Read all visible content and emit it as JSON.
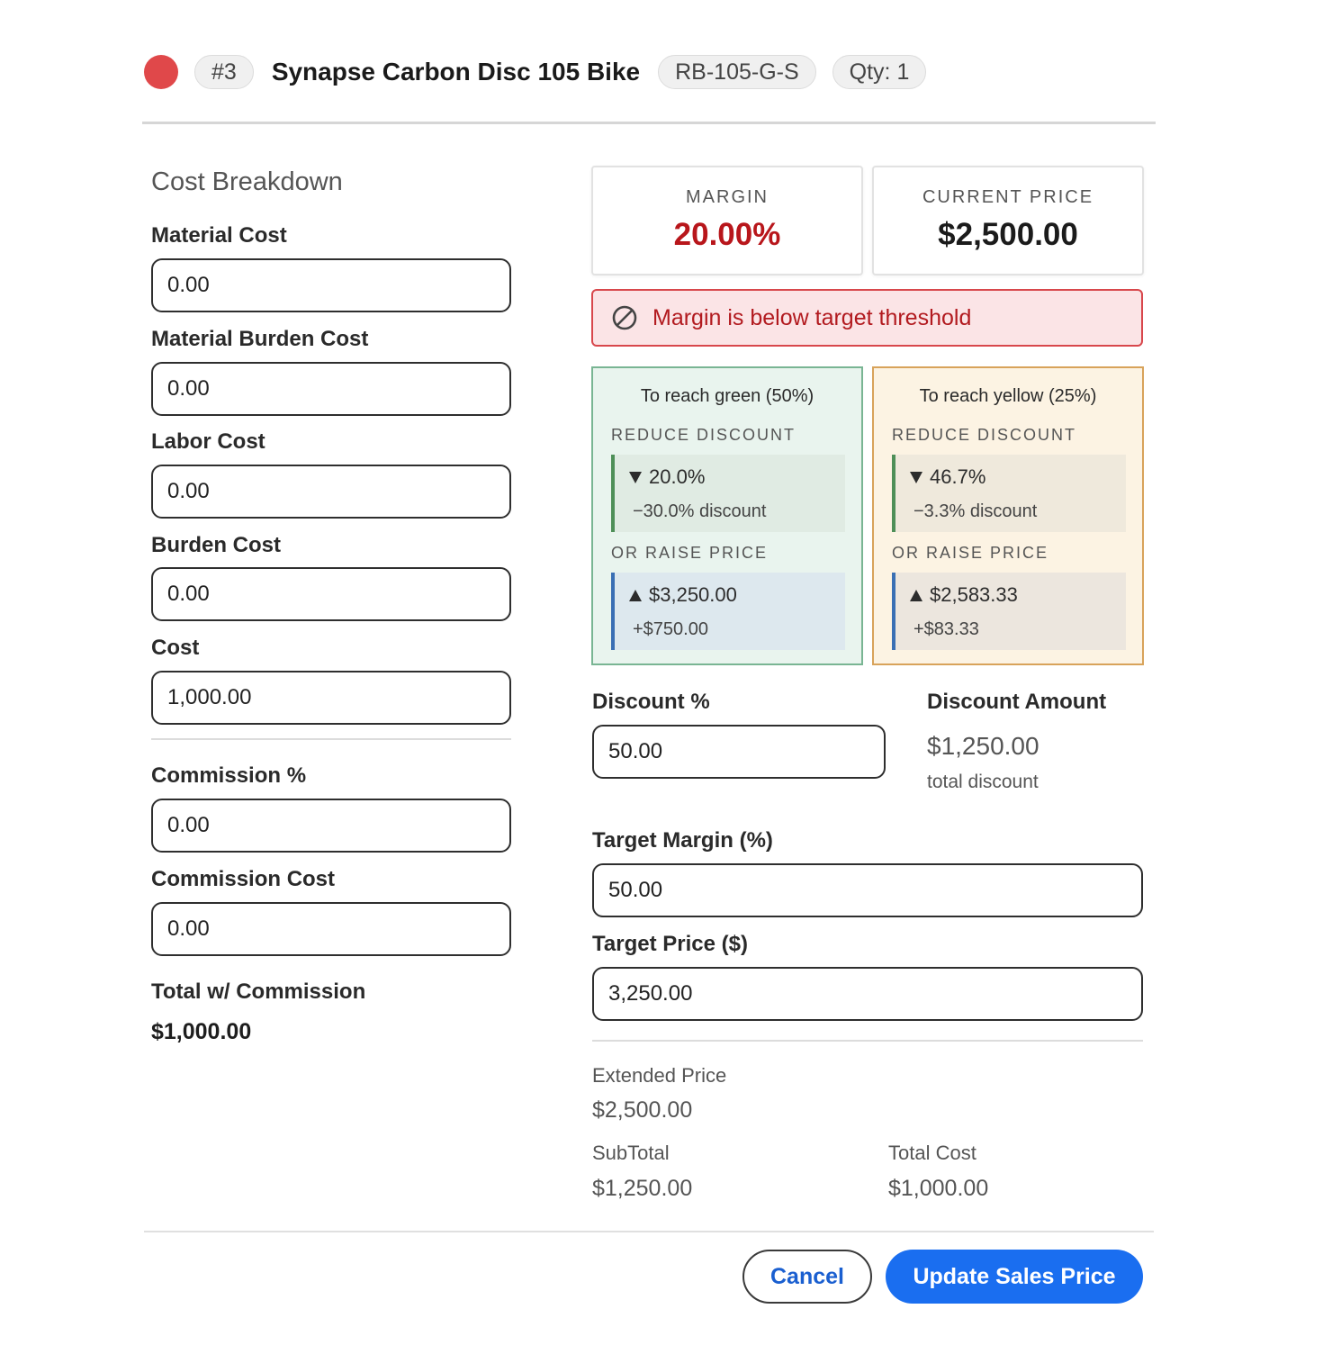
{
  "header": {
    "status_color": "#e0484a",
    "line_number": "#3",
    "title": "Synapse Carbon Disc 105 Bike",
    "sku": "RB-105-G-S",
    "qty": "Qty: 1"
  },
  "cost_breakdown": {
    "title": "Cost Breakdown",
    "fields": [
      {
        "label": "Material Cost",
        "value": "0.00"
      },
      {
        "label": "Material Burden Cost",
        "value": "0.00"
      },
      {
        "label": "Labor Cost",
        "value": "0.00"
      },
      {
        "label": "Burden Cost",
        "value": "0.00"
      },
      {
        "label": "Cost",
        "value": "1,000.00"
      }
    ],
    "commission_fields": [
      {
        "label": "Commission %",
        "value": "0.00"
      },
      {
        "label": "Commission Cost",
        "value": "0.00"
      }
    ],
    "total_label": "Total w/ Commission",
    "total_value": "$1,000.00"
  },
  "stats": {
    "margin_label": "MARGIN",
    "margin_value": "20.00%",
    "price_label": "CURRENT PRICE",
    "price_value": "$2,500.00"
  },
  "alert": {
    "text": "Margin is below target threshold",
    "icon": "prohibited-icon"
  },
  "targets": {
    "green": {
      "title": "To reach green (50%)",
      "reduce_caption": "REDUCE DISCOUNT",
      "reduce_value": "20.0%",
      "reduce_sub": "−30.0% discount",
      "raise_caption": "OR RAISE PRICE",
      "raise_value": "$3,250.00",
      "raise_sub": "+$750.00"
    },
    "yellow": {
      "title": "To reach yellow (25%)",
      "reduce_caption": "REDUCE DISCOUNT",
      "reduce_value": "46.7%",
      "reduce_sub": "−3.3% discount",
      "raise_caption": "OR RAISE PRICE",
      "raise_value": "$2,583.33",
      "raise_sub": "+$83.33"
    }
  },
  "discount": {
    "percent_label": "Discount %",
    "percent_value": "50.00",
    "amount_label": "Discount Amount",
    "amount_value": "$1,250.00",
    "amount_note": "total discount"
  },
  "target_margin": {
    "label": "Target Margin (%)",
    "value": "50.00"
  },
  "target_price": {
    "label": "Target Price ($)",
    "value": "3,250.00"
  },
  "summary": {
    "extended_label": "Extended Price",
    "extended_value": "$2,500.00",
    "subtotal_label": "SubTotal",
    "subtotal_value": "$1,250.00",
    "total_cost_label": "Total Cost",
    "total_cost_value": "$1,000.00"
  },
  "actions": {
    "cancel_label": "Cancel",
    "update_label": "Update Sales Price"
  }
}
